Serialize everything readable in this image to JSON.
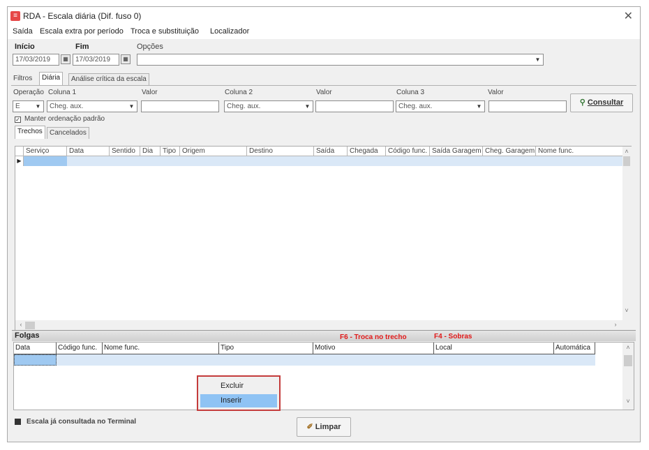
{
  "window": {
    "icon": "app-red-icon",
    "title": "RDA - Escala diária (Dif. fuso 0)",
    "close_glyph": "✕"
  },
  "menu": [
    "Saída",
    "Escala extra por período",
    "Troca e substituição",
    "Localizador"
  ],
  "period": {
    "inicio_label": "Início",
    "fim_label": "Fim",
    "opcoes_label": "Opções",
    "inicio_value": "17/03/2019",
    "fim_value": "17/03/2019"
  },
  "tabs_main": [
    "Filtros",
    "Diária",
    "Análise crítica da escala"
  ],
  "filters": {
    "operacao_label": "Operação",
    "coluna1_label": "Coluna 1",
    "valor1_label": "Valor",
    "coluna2_label": "Coluna 2",
    "valor2_label": "Valor",
    "coluna3_label": "Coluna 3",
    "valor3_label": "Valor",
    "operacao_value": "E",
    "coluna1_value": "Cheg. aux.",
    "coluna2_value": "Cheg. aux.",
    "coluna3_value": "Cheg. aux.",
    "manter_label": "Manter ordenação padrão",
    "manter_checked": "✓",
    "consultar_label": "Consultar"
  },
  "tabs_sub": [
    "Trechos",
    "Cancelados"
  ],
  "top_grid_columns": [
    "Serviço",
    "Data",
    "Sentido",
    "Dia",
    "Tipo",
    "Origem",
    "Destino",
    "Saída",
    "Chegada",
    "Código func.",
    "Saída Garagem",
    "Cheg. Garagem",
    "Nome func."
  ],
  "folgas": {
    "title": "Folgas",
    "hotkey_f6": "F6 - Troca no trecho",
    "hotkey_f4": "F4 - Sobras",
    "columns": [
      "Data",
      "Código func.",
      "Nome func.",
      "Tipo",
      "Motivo",
      "Local",
      "Automática"
    ]
  },
  "context_menu": [
    "Excluir",
    "Inserir"
  ],
  "footer": {
    "status_text": "Escala já consultada no Terminal",
    "limpar_label": "Limpar"
  },
  "colors": {
    "selection": "#dae8f7",
    "hotkey": "#e01818",
    "menu_highlight": "#8fc3f4"
  }
}
